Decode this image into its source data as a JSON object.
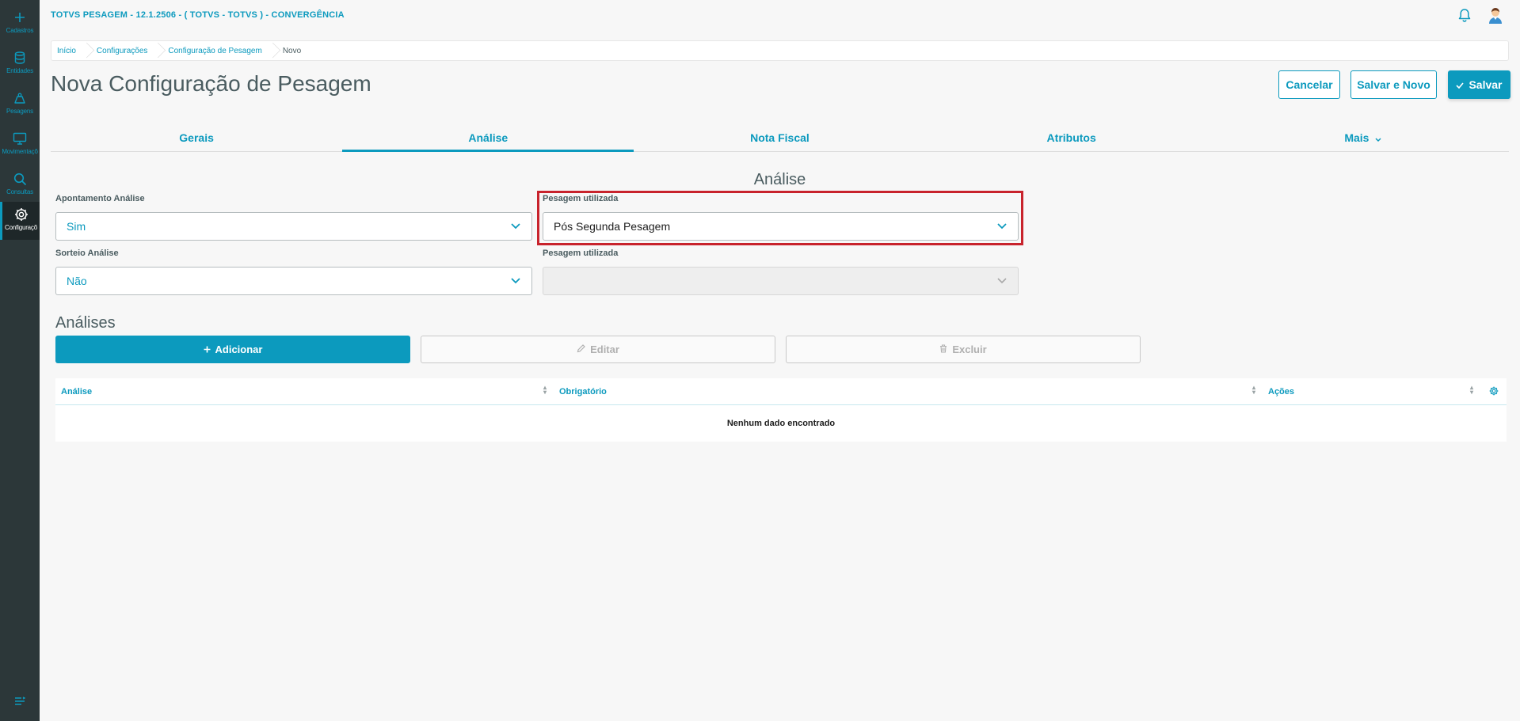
{
  "sidebar": {
    "items": [
      {
        "label": "Cadastros",
        "icon": "plus-icon"
      },
      {
        "label": "Entidades",
        "icon": "database-icon"
      },
      {
        "label": "Pesagens",
        "icon": "weight-icon"
      },
      {
        "label": "Movimentaçõ",
        "icon": "monitor-icon"
      },
      {
        "label": "Consultas",
        "icon": "search-icon"
      },
      {
        "label": "Configuraçõ",
        "icon": "gear-icon"
      }
    ],
    "toggle_icon": "menu-collapse-icon"
  },
  "header": {
    "app_title": "TOTVS PESAGEM - 12.1.2506 - ( TOTVS - TOTVS ) - CONVERGÊNCIA",
    "bell_icon": "bell-icon",
    "avatar_icon": "user-avatar-icon"
  },
  "breadcrumb": [
    "Início",
    "Configurações",
    "Configuração de Pesagem",
    "Novo"
  ],
  "page": {
    "title": "Nova Configuração de Pesagem",
    "actions": {
      "cancel": "Cancelar",
      "save_new": "Salvar e Novo",
      "save": "Salvar"
    }
  },
  "tabs": [
    "Gerais",
    "Análise",
    "Nota Fiscal",
    "Atributos",
    "Mais"
  ],
  "active_tab": "Análise",
  "form": {
    "section_title": "Análise",
    "apontamento": {
      "label": "Apontamento Análise",
      "value": "Sim"
    },
    "pesagem1": {
      "label": "Pesagem utilizada",
      "value": "Pós Segunda Pesagem"
    },
    "sorteio": {
      "label": "Sorteio Análise",
      "value": "Não"
    },
    "pesagem2": {
      "label": "Pesagem utilizada",
      "value": ""
    }
  },
  "analises": {
    "title": "Análises",
    "add": "Adicionar",
    "edit": "Editar",
    "delete": "Excluir",
    "columns": [
      "Análise",
      "Obrigatório",
      "Ações"
    ],
    "empty": "Nenhum dado encontrado"
  },
  "colors": {
    "accent": "#0c9abe",
    "sidebar": "#2c3739",
    "highlight": "#c8232c"
  }
}
